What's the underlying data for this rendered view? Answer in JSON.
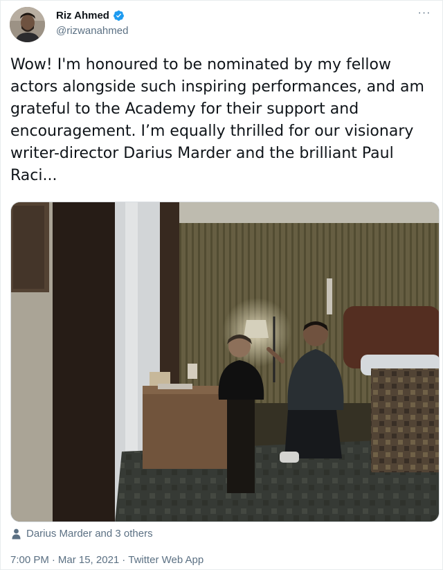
{
  "tweet": {
    "author": {
      "display_name": "Riz Ahmed",
      "handle": "@rizwanahmed",
      "verified": true
    },
    "more_icon": "more-horizontal-icon",
    "text": "Wow! I'm honoured to be nominated by my fellow\nactors alongside such inspiring performances, and am\ngrateful to the Academy for their support and\nencouragement. I’m equally thrilled for our visionary\nwriter-director Darius Marder and the brilliant Paul\nRaci...",
    "tagged_people": "Darius Marder and 3 others",
    "tagged_icon": "person-icon",
    "time": "7:00 PM",
    "separator": "·",
    "date": "Mar 15, 2021",
    "source": "Twitter Web App"
  },
  "colors": {
    "text": "#0f1419",
    "secondary": "#5b7083",
    "verified_badge": "#1d9bf0"
  }
}
